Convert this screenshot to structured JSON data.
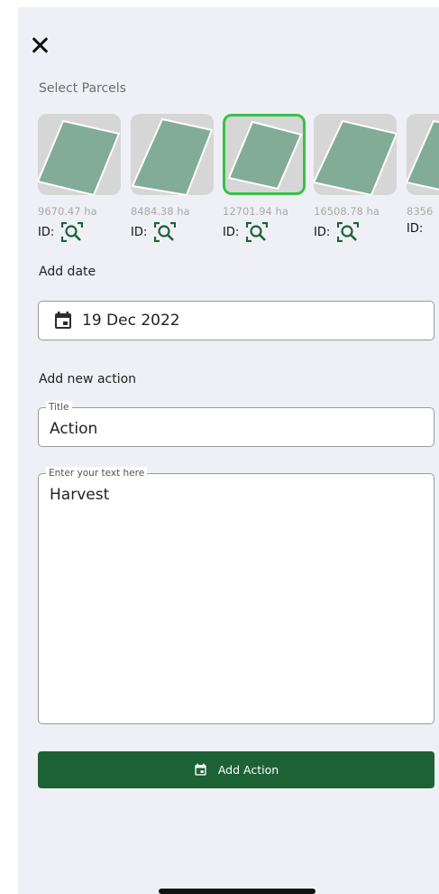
{
  "header": {
    "close_icon": "close-icon",
    "select_parcels_label": "Select Parcels"
  },
  "parcels": [
    {
      "area": "9670.47 ha",
      "id_label": "ID:",
      "selected": false
    },
    {
      "area": "8484.38 ha",
      "id_label": "ID:",
      "selected": false
    },
    {
      "area": "12701.94 ha",
      "id_label": "ID:",
      "selected": true
    },
    {
      "area": "16508.78 ha",
      "id_label": "ID:",
      "selected": false
    },
    {
      "area": "8356",
      "id_label": "ID:",
      "selected": false
    }
  ],
  "date_section": {
    "label": "Add date",
    "value": "19 Dec 2022",
    "icon": "calendar-icon"
  },
  "action_section": {
    "label": "Add new action",
    "title_field": {
      "legend": "Title",
      "value": "Action"
    },
    "text_field": {
      "legend": "Enter your text here",
      "value": "Harvest"
    }
  },
  "add_button": {
    "label": "Add Action",
    "icon": "calendar-icon"
  },
  "colors": {
    "primary": "#1c6235",
    "selected_border": "#37c14a",
    "parcel_fill": "#82ab98",
    "thumb_bg": "#d6d6d6",
    "background": "#eff0f5"
  }
}
